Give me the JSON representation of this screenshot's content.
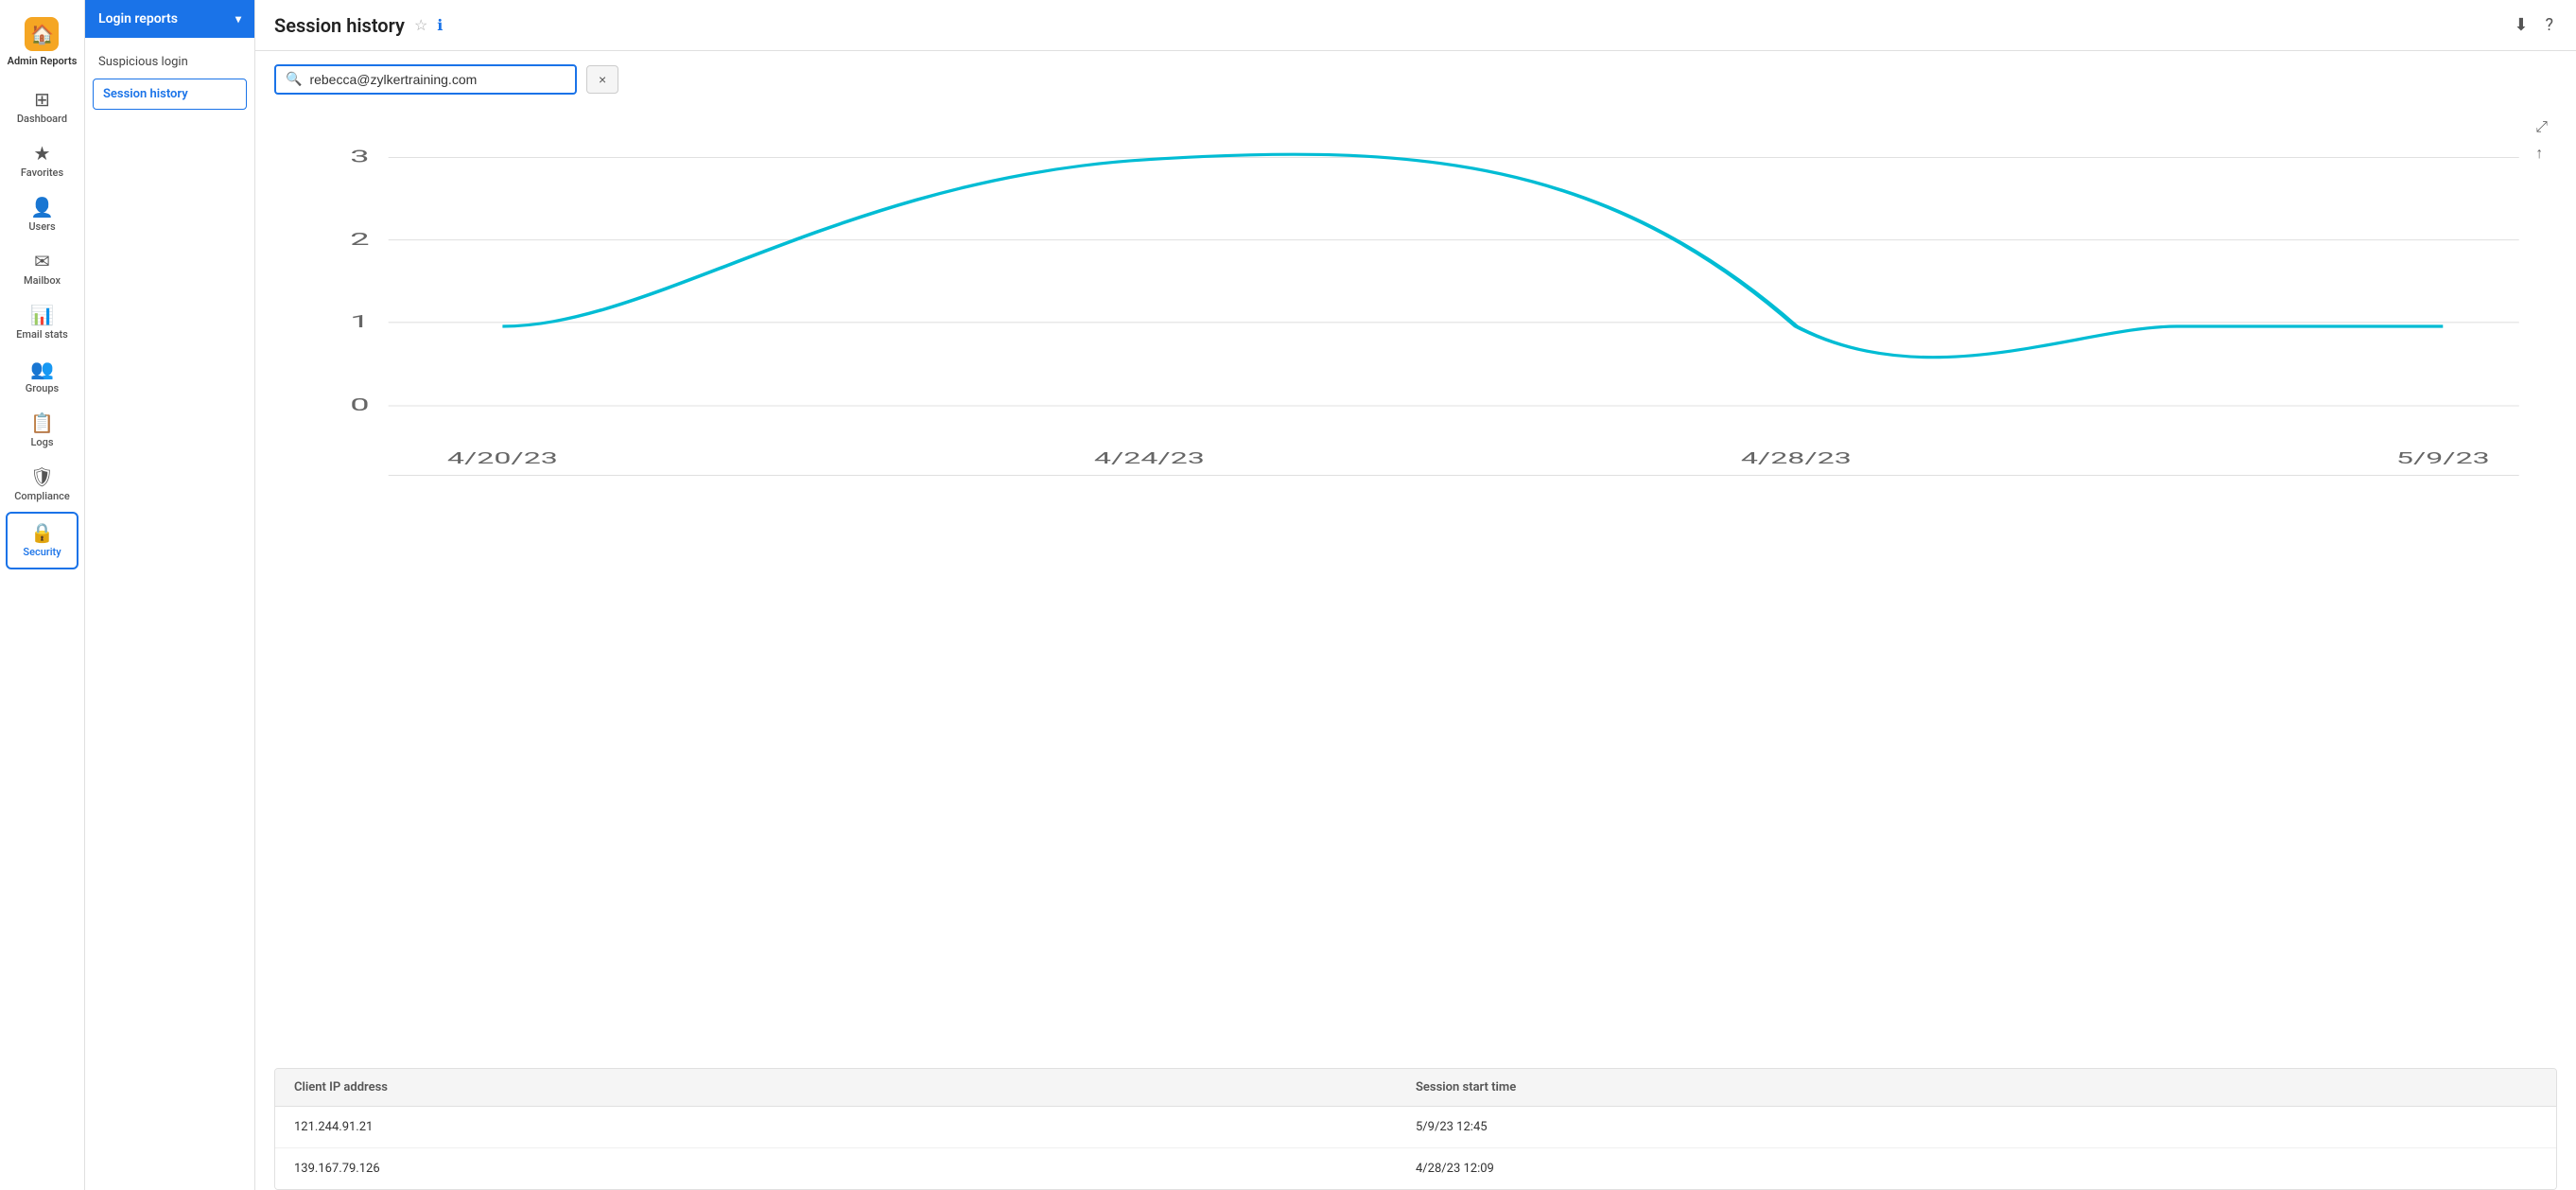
{
  "app": {
    "logo_emoji": "🏠",
    "title": "Admin Reports"
  },
  "sidebar": {
    "items": [
      {
        "id": "dashboard",
        "label": "Dashboard",
        "icon": "⊞",
        "active": false
      },
      {
        "id": "favorites",
        "label": "Favorites",
        "icon": "★",
        "active": false
      },
      {
        "id": "users",
        "label": "Users",
        "icon": "👤",
        "active": false
      },
      {
        "id": "mailbox",
        "label": "Mailbox",
        "icon": "✉",
        "active": false
      },
      {
        "id": "email-stats",
        "label": "Email stats",
        "icon": "📊",
        "active": false
      },
      {
        "id": "groups",
        "label": "Groups",
        "icon": "👥",
        "active": false
      },
      {
        "id": "logs",
        "label": "Logs",
        "icon": "📋",
        "active": false
      },
      {
        "id": "compliance",
        "label": "Compliance",
        "icon": "🛡",
        "active": false
      },
      {
        "id": "security",
        "label": "Security",
        "icon": "🔒",
        "active": true
      }
    ]
  },
  "second_panel": {
    "header": "Login reports",
    "items": [
      {
        "id": "suspicious-login",
        "label": "Suspicious login",
        "active": false
      },
      {
        "id": "session-history",
        "label": "Session history",
        "active": true
      }
    ]
  },
  "topbar": {
    "title": "Session history",
    "star_label": "☆",
    "info_label": "ℹ",
    "download_label": "⬇",
    "help_label": "?"
  },
  "search": {
    "placeholder": "Search",
    "value": "rebecca@zylkertraining.com",
    "clear_label": "×"
  },
  "chart": {
    "x_labels": [
      "4/20/23",
      "4/24/23",
      "4/28/23",
      "5/9/23"
    ],
    "y_labels": [
      "0",
      "1",
      "2",
      "3"
    ],
    "color": "#00bcd4"
  },
  "table": {
    "columns": [
      "Client IP address",
      "Session start time"
    ],
    "rows": [
      {
        "ip": "121.244.91.21",
        "time": "5/9/23 12:45"
      },
      {
        "ip": "139.167.79.126",
        "time": "4/28/23 12:09"
      }
    ]
  }
}
